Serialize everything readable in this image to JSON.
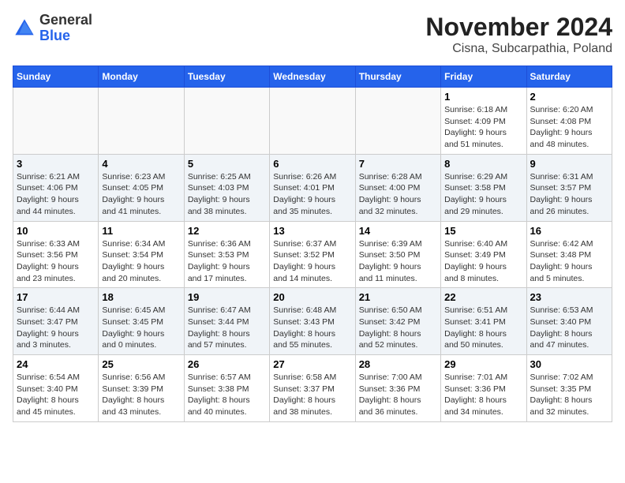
{
  "header": {
    "logo_general": "General",
    "logo_blue": "Blue",
    "month_year": "November 2024",
    "location": "Cisna, Subcarpathia, Poland"
  },
  "weekdays": [
    "Sunday",
    "Monday",
    "Tuesday",
    "Wednesday",
    "Thursday",
    "Friday",
    "Saturday"
  ],
  "weeks": [
    [
      {
        "day": "",
        "info": ""
      },
      {
        "day": "",
        "info": ""
      },
      {
        "day": "",
        "info": ""
      },
      {
        "day": "",
        "info": ""
      },
      {
        "day": "",
        "info": ""
      },
      {
        "day": "1",
        "info": "Sunrise: 6:18 AM\nSunset: 4:09 PM\nDaylight: 9 hours\nand 51 minutes."
      },
      {
        "day": "2",
        "info": "Sunrise: 6:20 AM\nSunset: 4:08 PM\nDaylight: 9 hours\nand 48 minutes."
      }
    ],
    [
      {
        "day": "3",
        "info": "Sunrise: 6:21 AM\nSunset: 4:06 PM\nDaylight: 9 hours\nand 44 minutes."
      },
      {
        "day": "4",
        "info": "Sunrise: 6:23 AM\nSunset: 4:05 PM\nDaylight: 9 hours\nand 41 minutes."
      },
      {
        "day": "5",
        "info": "Sunrise: 6:25 AM\nSunset: 4:03 PM\nDaylight: 9 hours\nand 38 minutes."
      },
      {
        "day": "6",
        "info": "Sunrise: 6:26 AM\nSunset: 4:01 PM\nDaylight: 9 hours\nand 35 minutes."
      },
      {
        "day": "7",
        "info": "Sunrise: 6:28 AM\nSunset: 4:00 PM\nDaylight: 9 hours\nand 32 minutes."
      },
      {
        "day": "8",
        "info": "Sunrise: 6:29 AM\nSunset: 3:58 PM\nDaylight: 9 hours\nand 29 minutes."
      },
      {
        "day": "9",
        "info": "Sunrise: 6:31 AM\nSunset: 3:57 PM\nDaylight: 9 hours\nand 26 minutes."
      }
    ],
    [
      {
        "day": "10",
        "info": "Sunrise: 6:33 AM\nSunset: 3:56 PM\nDaylight: 9 hours\nand 23 minutes."
      },
      {
        "day": "11",
        "info": "Sunrise: 6:34 AM\nSunset: 3:54 PM\nDaylight: 9 hours\nand 20 minutes."
      },
      {
        "day": "12",
        "info": "Sunrise: 6:36 AM\nSunset: 3:53 PM\nDaylight: 9 hours\nand 17 minutes."
      },
      {
        "day": "13",
        "info": "Sunrise: 6:37 AM\nSunset: 3:52 PM\nDaylight: 9 hours\nand 14 minutes."
      },
      {
        "day": "14",
        "info": "Sunrise: 6:39 AM\nSunset: 3:50 PM\nDaylight: 9 hours\nand 11 minutes."
      },
      {
        "day": "15",
        "info": "Sunrise: 6:40 AM\nSunset: 3:49 PM\nDaylight: 9 hours\nand 8 minutes."
      },
      {
        "day": "16",
        "info": "Sunrise: 6:42 AM\nSunset: 3:48 PM\nDaylight: 9 hours\nand 5 minutes."
      }
    ],
    [
      {
        "day": "17",
        "info": "Sunrise: 6:44 AM\nSunset: 3:47 PM\nDaylight: 9 hours\nand 3 minutes."
      },
      {
        "day": "18",
        "info": "Sunrise: 6:45 AM\nSunset: 3:45 PM\nDaylight: 9 hours\nand 0 minutes."
      },
      {
        "day": "19",
        "info": "Sunrise: 6:47 AM\nSunset: 3:44 PM\nDaylight: 8 hours\nand 57 minutes."
      },
      {
        "day": "20",
        "info": "Sunrise: 6:48 AM\nSunset: 3:43 PM\nDaylight: 8 hours\nand 55 minutes."
      },
      {
        "day": "21",
        "info": "Sunrise: 6:50 AM\nSunset: 3:42 PM\nDaylight: 8 hours\nand 52 minutes."
      },
      {
        "day": "22",
        "info": "Sunrise: 6:51 AM\nSunset: 3:41 PM\nDaylight: 8 hours\nand 50 minutes."
      },
      {
        "day": "23",
        "info": "Sunrise: 6:53 AM\nSunset: 3:40 PM\nDaylight: 8 hours\nand 47 minutes."
      }
    ],
    [
      {
        "day": "24",
        "info": "Sunrise: 6:54 AM\nSunset: 3:40 PM\nDaylight: 8 hours\nand 45 minutes."
      },
      {
        "day": "25",
        "info": "Sunrise: 6:56 AM\nSunset: 3:39 PM\nDaylight: 8 hours\nand 43 minutes."
      },
      {
        "day": "26",
        "info": "Sunrise: 6:57 AM\nSunset: 3:38 PM\nDaylight: 8 hours\nand 40 minutes."
      },
      {
        "day": "27",
        "info": "Sunrise: 6:58 AM\nSunset: 3:37 PM\nDaylight: 8 hours\nand 38 minutes."
      },
      {
        "day": "28",
        "info": "Sunrise: 7:00 AM\nSunset: 3:36 PM\nDaylight: 8 hours\nand 36 minutes."
      },
      {
        "day": "29",
        "info": "Sunrise: 7:01 AM\nSunset: 3:36 PM\nDaylight: 8 hours\nand 34 minutes."
      },
      {
        "day": "30",
        "info": "Sunrise: 7:02 AM\nSunset: 3:35 PM\nDaylight: 8 hours\nand 32 minutes."
      }
    ]
  ]
}
